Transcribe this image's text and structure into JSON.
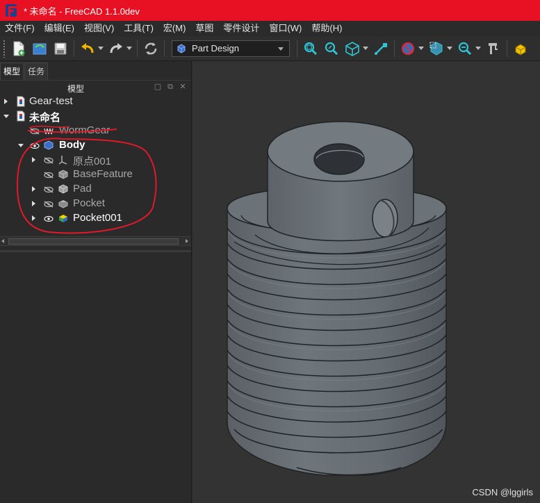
{
  "window": {
    "title": "* 未命名 - FreeCAD 1.1.0dev"
  },
  "menu": [
    "文件(F)",
    "编辑(E)",
    "视图(V)",
    "工具(T)",
    "宏(M)",
    "草图",
    "零件设计",
    "窗口(W)",
    "帮助(H)"
  ],
  "toolbar": {
    "workbench": "Part Design"
  },
  "panel": {
    "tabs": [
      "模型",
      "任务"
    ],
    "header": "模型",
    "tree": [
      {
        "label": "Gear-test"
      },
      {
        "label": "未命名"
      },
      {
        "label": "WormGear"
      },
      {
        "label": "Body"
      },
      {
        "label": "原点001"
      },
      {
        "label": "BaseFeature"
      },
      {
        "label": "Pad"
      },
      {
        "label": "Pocket"
      },
      {
        "label": "Pocket001"
      }
    ]
  },
  "watermark": "CSDN @lggirls",
  "colors": {
    "titlebar": "#e81123",
    "model": "#636a70",
    "annotation": "#e0192a"
  }
}
